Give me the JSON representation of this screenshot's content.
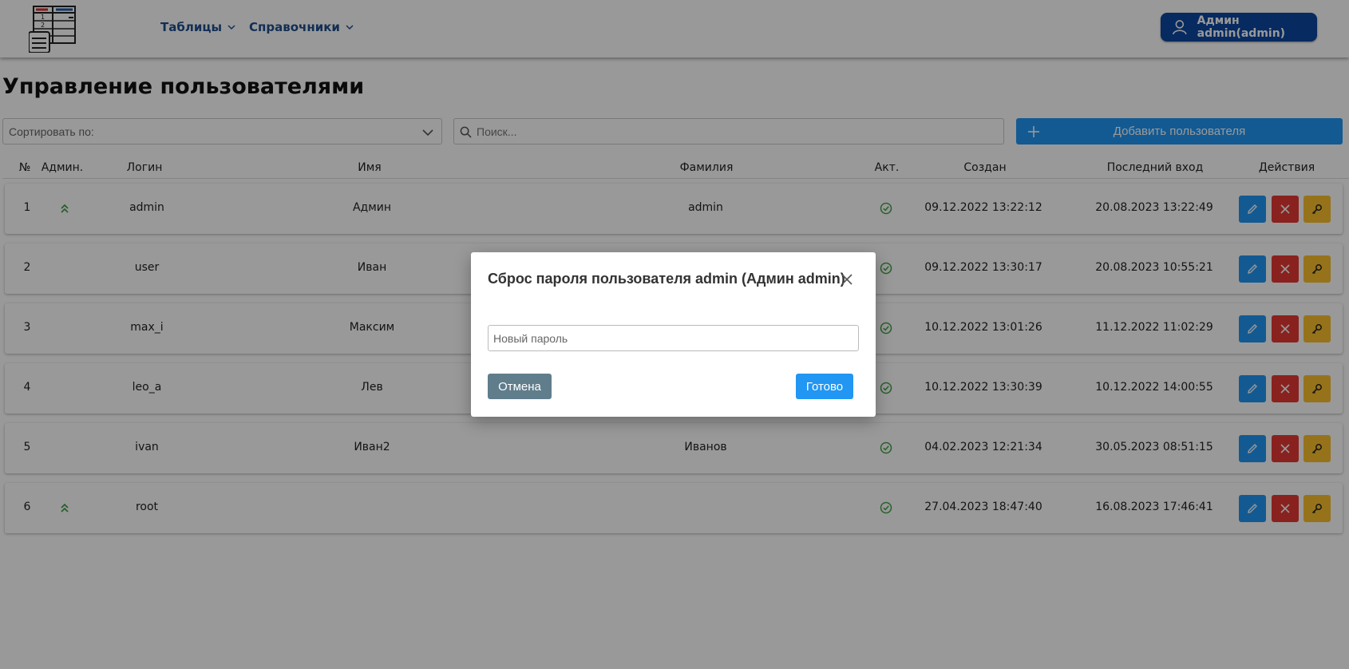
{
  "header": {
    "nav": [
      {
        "label": "Таблицы"
      },
      {
        "label": "Справочники"
      }
    ],
    "user_label": "Админ admin(admin)"
  },
  "page_title": "Управление пользователями",
  "toolbar": {
    "sort_label": "Сортировать по:",
    "search_placeholder": "Поиск...",
    "add_label": "Добавить пользователя"
  },
  "table": {
    "columns": [
      "№",
      "Админ.",
      "Логин",
      "Имя",
      "Фамилия",
      "Акт.",
      "Создан",
      "Последний вход",
      "Действия"
    ],
    "rows": [
      {
        "num": "1",
        "admin": true,
        "login": "admin",
        "name": "Админ",
        "surname": "admin",
        "active": true,
        "created": "09.12.2022 13:22:12",
        "last_login": "20.08.2023 13:22:49"
      },
      {
        "num": "2",
        "admin": false,
        "login": "user",
        "name": "Иван",
        "surname": "",
        "active": true,
        "created": "09.12.2022 13:30:17",
        "last_login": "20.08.2023 10:55:21"
      },
      {
        "num": "3",
        "admin": false,
        "login": "max_i",
        "name": "Максим",
        "surname": "",
        "active": true,
        "created": "10.12.2022 13:01:26",
        "last_login": "11.12.2022 11:02:29"
      },
      {
        "num": "4",
        "admin": false,
        "login": "leo_a",
        "name": "Лев",
        "surname": "",
        "active": true,
        "created": "10.12.2022 13:30:39",
        "last_login": "10.12.2022 14:00:55"
      },
      {
        "num": "5",
        "admin": false,
        "login": "ivan",
        "name": "Иван2",
        "surname": "Иванов",
        "active": true,
        "created": "04.02.2023 12:21:34",
        "last_login": "30.05.2023 08:51:15"
      },
      {
        "num": "6",
        "admin": true,
        "login": "root",
        "name": "",
        "surname": "",
        "active": true,
        "created": "27.04.2023 18:47:40",
        "last_login": "16.08.2023 17:46:41"
      }
    ]
  },
  "modal": {
    "title": "Сброс пароля пользователя admin (Админ admin)",
    "password_placeholder": "Новый пароль",
    "cancel_label": "Отмена",
    "ok_label": "Готово"
  },
  "colors": {
    "brand": "#0d47a1",
    "primary": "#2196f3",
    "danger": "#e53935",
    "warning": "#fbc02d",
    "success": "#43a047",
    "secondary": "#607d8b"
  },
  "icons": [
    "app-logo-icon",
    "chevron-down-icon",
    "user-icon",
    "search-icon",
    "plus-icon",
    "admin-chevrons-up-icon",
    "check-circle-icon",
    "pencil-icon",
    "close-icon",
    "key-icon"
  ]
}
